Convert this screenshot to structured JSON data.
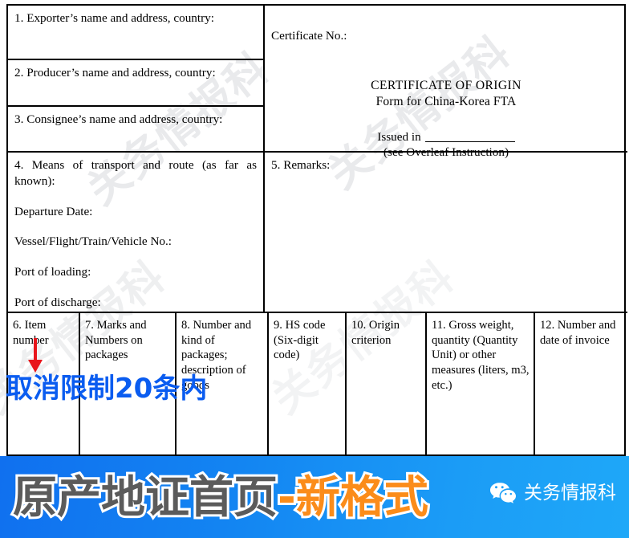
{
  "document": {
    "boxes": {
      "exporter": "1. Exporter’s name and address, country:",
      "producer": "2. Producer’s name and address, country:",
      "consignee": "3. Consignee’s name and address, country:",
      "transport_heading_line1": "4. Means of transport and route (as far as",
      "transport_heading_line2": "known):",
      "transport_departure": "Departure Date:",
      "transport_vessel": "Vessel/Flight/Train/Vehicle No.:",
      "transport_port_loading": "Port of loading:",
      "transport_port_discharge": "Port of discharge:",
      "certificate_no": "Certificate No.:",
      "certificate_title": "CERTIFICATE OF ORIGIN",
      "certificate_subtitle": "Form for China-Korea FTA",
      "issued_in": "Issued in",
      "overleaf_note": "(see Overleaf Instruction)",
      "remarks": "5. Remarks:"
    },
    "columns": [
      {
        "id": "6",
        "label": "6. Item number"
      },
      {
        "id": "7",
        "label": "7. Marks and Numbers on packages"
      },
      {
        "id": "8",
        "label": "8. Number and kind of packages; description of goods"
      },
      {
        "id": "9",
        "label": "9. HS code (Six-digit code)"
      },
      {
        "id": "10",
        "label": "10. Origin criterion"
      },
      {
        "id": "11",
        "label": "11. Gross weight, quantity (Quantity Unit) or other measures (liters, m3, etc.)"
      },
      {
        "id": "12",
        "label": "12. Number and date of invoice"
      }
    ],
    "watermark": "关务情报科"
  },
  "annotations": {
    "note_text": "取消限制20条内",
    "note_color": "#0a5cf0",
    "arrow_color": "#e8151b"
  },
  "banner": {
    "title_main": "原产地证首页",
    "title_accent": "-新格式",
    "main_color": "#5b5b5b",
    "accent_color": "#fb8c1a",
    "outline_color": "#ffffff",
    "bg_start": "#1070ef",
    "bg_end": "#1fa8f8",
    "wechat_label": "关务情报科"
  }
}
